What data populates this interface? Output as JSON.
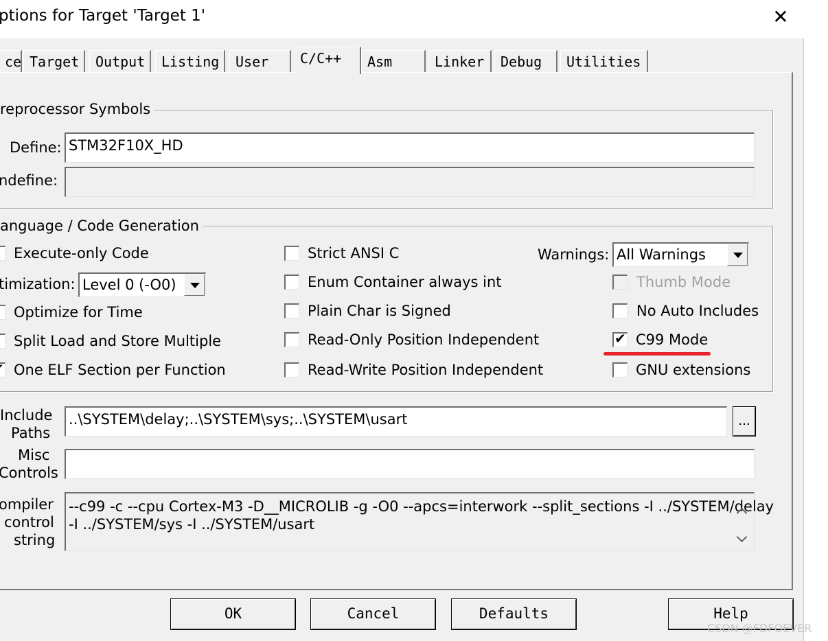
{
  "window": {
    "title": "ptions for Target 'Target 1'",
    "close_glyph": "✕"
  },
  "tabs": [
    {
      "label": "ce"
    },
    {
      "label": "Target"
    },
    {
      "label": "Output"
    },
    {
      "label": "Listing"
    },
    {
      "label": "User"
    },
    {
      "label": "C/C++"
    },
    {
      "label": "Asm"
    },
    {
      "label": "Linker"
    },
    {
      "label": "Debug"
    },
    {
      "label": "Utilities"
    }
  ],
  "active_tab": "C/C++",
  "preprocessor": {
    "legend": "reprocessor Symbols",
    "define_label": "Define:",
    "define_value": "STM32F10X_HD",
    "undefine_label": "ndefine:",
    "undefine_value": ""
  },
  "language": {
    "legend": "anguage / Code Generation",
    "col1": {
      "execute_only": {
        "label": "Execute-only Code",
        "checked": false
      },
      "optimization_label": "timization:",
      "optimization_value": "Level 0 (-O0)",
      "optimize_time": {
        "label": "Optimize for Time",
        "checked": false
      },
      "split_load": {
        "label": "Split Load and Store Multiple",
        "checked": false
      },
      "one_elf": {
        "label": "One ELF Section per Function",
        "checked": true
      }
    },
    "col2": {
      "strict_ansi": {
        "label": "Strict ANSI C",
        "checked": false
      },
      "enum_container": {
        "label": "Enum Container always int",
        "checked": false
      },
      "plain_char": {
        "label": "Plain Char is Signed",
        "checked": false
      },
      "ro_pi": {
        "label": "Read-Only Position Independent",
        "checked": false
      },
      "rw_pi": {
        "label": "Read-Write Position Independent",
        "checked": false
      }
    },
    "col3": {
      "warnings_label": "Warnings:",
      "warnings_value": "All Warnings",
      "thumb_mode": {
        "label": "Thumb Mode",
        "checked": false,
        "disabled": true
      },
      "no_auto_includes": {
        "label": "No Auto Includes",
        "checked": false
      },
      "c99_mode": {
        "label": "C99 Mode",
        "checked": true,
        "highlighted": true
      },
      "gnu_ext": {
        "label": "GNU extensions",
        "checked": false
      }
    },
    "checkmark_glyph": "✔"
  },
  "include": {
    "label_line1": "Include",
    "label_line2": "Paths",
    "value": "..\\SYSTEM\\delay;..\\SYSTEM\\sys;..\\SYSTEM\\usart",
    "browse_label": "..."
  },
  "misc": {
    "label_line1": "Misc",
    "label_line2": "Controls",
    "value": ""
  },
  "compiler": {
    "label_line1": "ompiler",
    "label_line2": "control",
    "label_line3": "string",
    "line1": "--c99 -c --cpu Cortex-M3 -D__MICROLIB -g -O0 --apcs=interwork --split_sections -I ../SYSTEM/delay",
    "line2": "-I ../SYSTEM/sys -I ../SYSTEM/usart"
  },
  "buttons": {
    "ok": "OK",
    "cancel": "Cancel",
    "defaults": "Defaults",
    "help": "Help"
  },
  "watermark": "CSDN @FDFOEVER",
  "colors": {
    "dialog_bg": "#f0f0f0",
    "highlight_underline": "#e8222a"
  }
}
